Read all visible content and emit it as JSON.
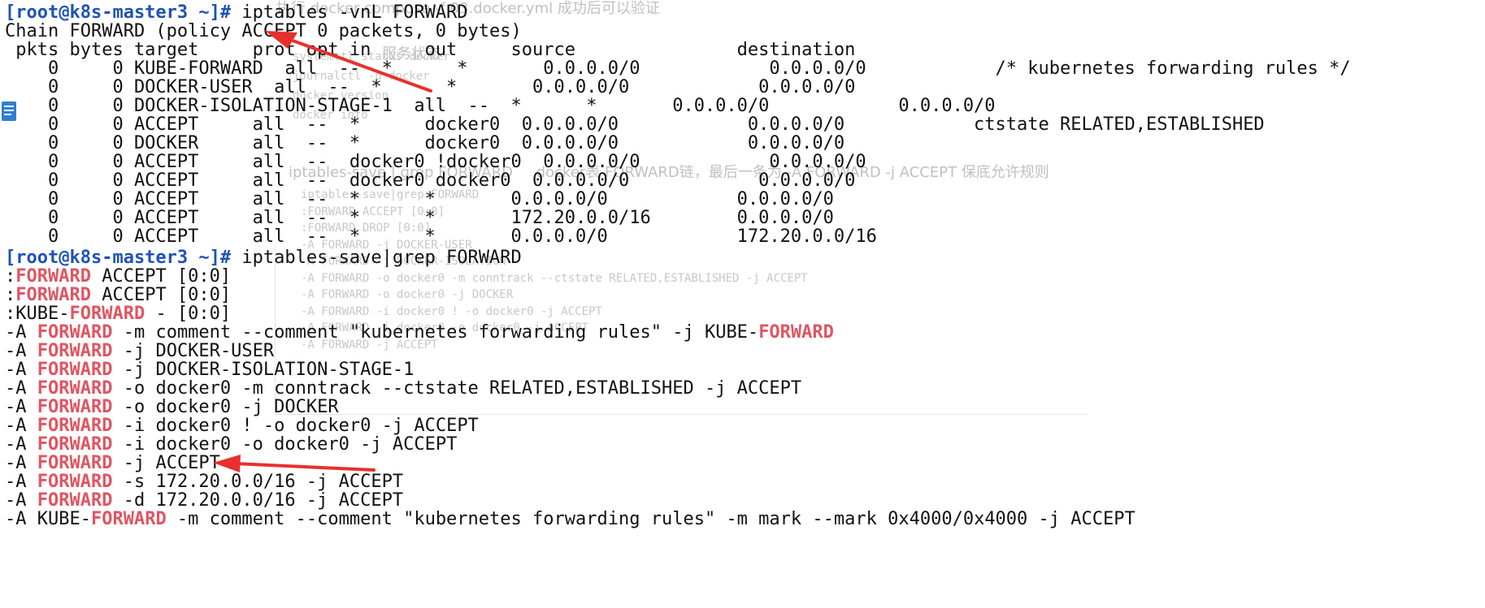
{
  "colors": {
    "background": "#ffffff",
    "text": "#111111",
    "prompt": "#1f53b5",
    "grep_highlight": "#e05562",
    "arrow": "#e8302e",
    "ghost_text": "#c8c8c8"
  },
  "icons": [
    "document-icon",
    "red-arrow-annotation"
  ],
  "background_ghost": {
    "top_note": "执行 docker compose -f 03.docker.yml 成功后可以验证",
    "status_label": "服务状态",
    "status_lines": [
      "systemctl status docker",
      "journalctl -u docker",
      "docker version",
      "docker info"
    ],
    "save_note": "iptables-save | grep FORWARD     docker表 FORWARD链，最后一条为 -A FORWARD -j ACCEPT 保底允许规则",
    "grep_lines": [
      "iptables-save|grep FORWARD",
      ":FORWARD ACCEPT [0:0]",
      ":FORWARD DROP [0:0]",
      "-A FORWARD -j DOCKER-USER",
      "-A FORWARD -j DOCKER-ISOLATION",
      "-A FORWARD -o docker0 -m conntrack --ctstate RELATED,ESTABLISHED -j ACCEPT",
      "-A FORWARD -o docker0 -j DOCKER",
      "-A FORWARD -i docker0 ! -o docker0 -j ACCEPT",
      "-A FORWARD -i docker0 -o docker0 -j ACCEPT",
      "-A FORWARD -j ACCEPT"
    ]
  },
  "terminal": {
    "prompt": "[root@k8s-master3 ~]#",
    "command_1": " iptables -vnL FORWARD",
    "chain_header": "Chain FORWARD (policy ACCEPT 0 packets, 0 bytes)",
    "column_header": " pkts bytes target     prot opt in     out     source               destination",
    "rules": [
      "    0     0 KUBE-FORWARD  all  --  *      *       0.0.0.0/0            0.0.0.0/0            /* kubernetes forwarding rules */",
      "    0     0 DOCKER-USER  all  --  *      *       0.0.0.0/0            0.0.0.0/0",
      "    0     0 DOCKER-ISOLATION-STAGE-1  all  --  *      *       0.0.0.0/0            0.0.0.0/0",
      "    0     0 ACCEPT     all  --  *      docker0  0.0.0.0/0            0.0.0.0/0            ctstate RELATED,ESTABLISHED",
      "    0     0 DOCKER     all  --  *      docker0  0.0.0.0/0            0.0.0.0/0",
      "    0     0 ACCEPT     all  --  docker0 !docker0  0.0.0.0/0            0.0.0.0/0",
      "    0     0 ACCEPT     all  --  docker0 docker0  0.0.0.0/0            0.0.0.0/0",
      "    0     0 ACCEPT     all  --  *      *       0.0.0.0/0            0.0.0.0/0",
      "    0     0 ACCEPT     all  --  *      *       172.20.0.0/16        0.0.0.0/0",
      "    0     0 ACCEPT     all  --  *      *       0.0.0.0/0            172.20.0.0/16"
    ],
    "command_2": " iptables-save|grep FORWARD",
    "save_output": [
      {
        "before": ":",
        "match": "FORWARD",
        "after": " ACCEPT [0:0]"
      },
      {
        "before": ":",
        "match": "FORWARD",
        "after": " ACCEPT [0:0]"
      },
      {
        "before": ":KUBE-",
        "match": "FORWARD",
        "after": " - [0:0]"
      },
      {
        "before": "-A ",
        "match": "FORWARD",
        "after": " -m comment --comment \"kubernetes forwarding rules\" -j KUBE-",
        "match2": "FORWARD"
      },
      {
        "before": "-A ",
        "match": "FORWARD",
        "after": " -j DOCKER-USER"
      },
      {
        "before": "-A ",
        "match": "FORWARD",
        "after": " -j DOCKER-ISOLATION-STAGE-1"
      },
      {
        "before": "-A ",
        "match": "FORWARD",
        "after": " -o docker0 -m conntrack --ctstate RELATED,ESTABLISHED -j ACCEPT"
      },
      {
        "before": "-A ",
        "match": "FORWARD",
        "after": " -o docker0 -j DOCKER"
      },
      {
        "before": "-A ",
        "match": "FORWARD",
        "after": " -i docker0 ! -o docker0 -j ACCEPT"
      },
      {
        "before": "-A ",
        "match": "FORWARD",
        "after": " -i docker0 -o docker0 -j ACCEPT"
      },
      {
        "before": "-A ",
        "match": "FORWARD",
        "after": " -j ACCEPT"
      },
      {
        "before": "-A ",
        "match": "FORWARD",
        "after": " -s 172.20.0.0/16 -j ACCEPT"
      },
      {
        "before": "-A ",
        "match": "FORWARD",
        "after": " -d 172.20.0.0/16 -j ACCEPT"
      },
      {
        "before": "-A KUBE-",
        "match": "FORWARD",
        "after": " -m comment --comment \"kubernetes forwarding rules\" -m mark --mark 0x4000/0x4000 -j ACCEPT"
      }
    ]
  }
}
